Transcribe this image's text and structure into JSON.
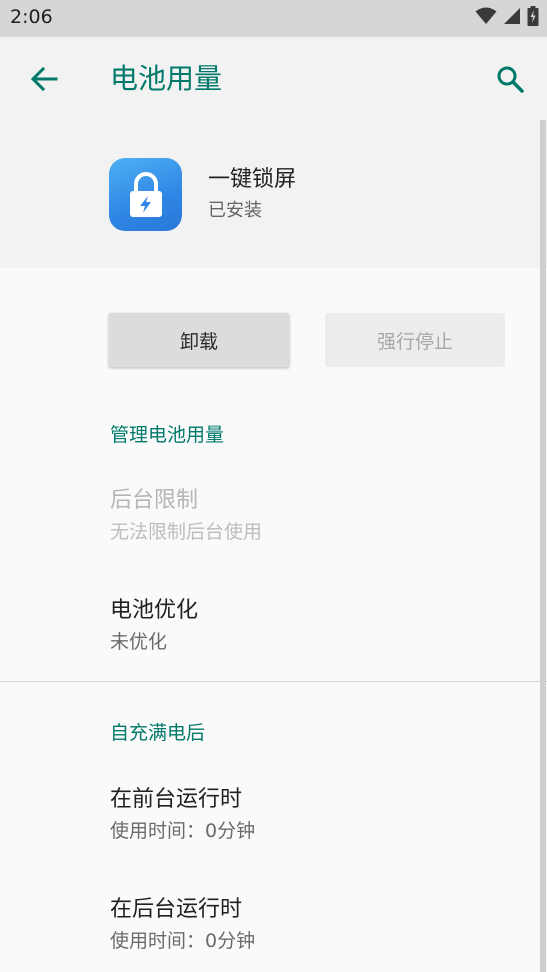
{
  "status_bar": {
    "time": "2:06",
    "icons": [
      "wifi-icon",
      "cellular-signal-icon",
      "battery-charging-icon"
    ]
  },
  "header": {
    "back_icon": "arrow-back-icon",
    "title": "电池用量",
    "search_icon": "search-icon"
  },
  "app": {
    "icon": "lock-app-icon",
    "name": "一键锁屏",
    "status": "已安装"
  },
  "buttons": {
    "uninstall": "卸载",
    "force_stop": "强行停止"
  },
  "manage_section": {
    "header": "管理电池用量",
    "items": [
      {
        "title": "后台限制",
        "summary": "无法限制后台使用",
        "enabled": false
      },
      {
        "title": "电池优化",
        "summary": "未优化",
        "enabled": true
      }
    ]
  },
  "usage_section": {
    "header": "自充满电后",
    "items": [
      {
        "title": "在前台运行时",
        "summary": "使用时间：0分钟"
      },
      {
        "title": "在后台运行时",
        "summary": "使用时间：0分钟"
      }
    ]
  },
  "colors": {
    "accent": "#00796b",
    "status_bar_bg": "#d6d6d6",
    "header_bg": "#f2f2f2",
    "app_icon_blue": "#2f86e4"
  }
}
